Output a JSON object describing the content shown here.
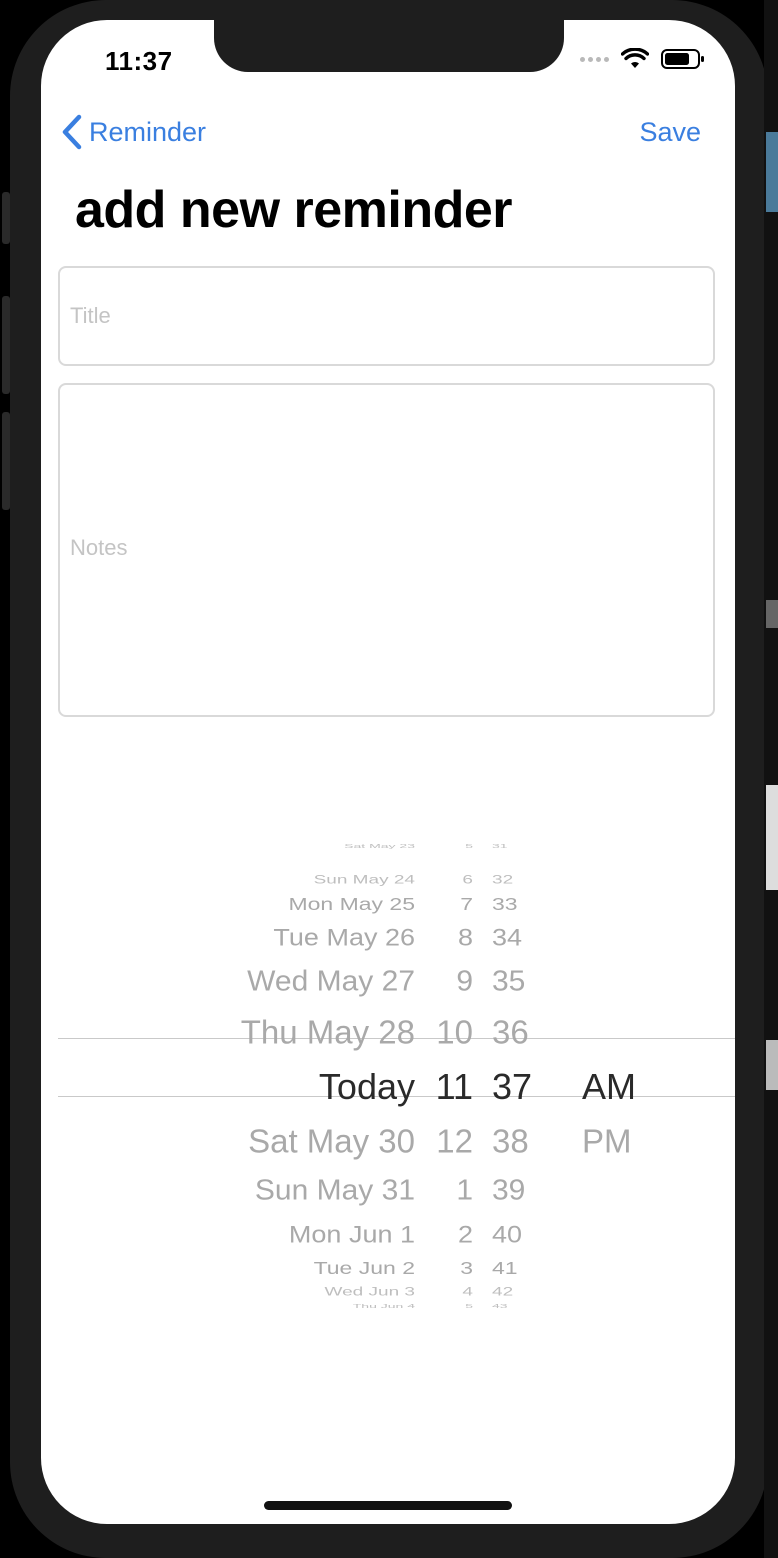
{
  "status_bar": {
    "time": "11:37"
  },
  "nav": {
    "back_label": "Reminder",
    "save_label": "Save"
  },
  "page": {
    "title": "add new reminder"
  },
  "form": {
    "title_placeholder": "Title",
    "title_value": "",
    "notes_placeholder": "Notes",
    "notes_value": ""
  },
  "picker": {
    "rows": [
      {
        "date": "Sat May 23",
        "hour": "5",
        "minute": "31",
        "ampm": ""
      },
      {
        "date": "Sun May 24",
        "hour": "6",
        "minute": "32",
        "ampm": ""
      },
      {
        "date": "Mon May 25",
        "hour": "7",
        "minute": "33",
        "ampm": ""
      },
      {
        "date": "Tue May 26",
        "hour": "8",
        "minute": "34",
        "ampm": ""
      },
      {
        "date": "Wed May 27",
        "hour": "9",
        "minute": "35",
        "ampm": ""
      },
      {
        "date": "Thu May 28",
        "hour": "10",
        "minute": "36",
        "ampm": ""
      },
      {
        "date": "Today",
        "hour": "11",
        "minute": "37",
        "ampm": "AM"
      },
      {
        "date": "Sat May 30",
        "hour": "12",
        "minute": "38",
        "ampm": "PM"
      },
      {
        "date": "Sun May 31",
        "hour": "1",
        "minute": "39",
        "ampm": ""
      },
      {
        "date": "Mon Jun 1",
        "hour": "2",
        "minute": "40",
        "ampm": ""
      },
      {
        "date": "Tue Jun 2",
        "hour": "3",
        "minute": "41",
        "ampm": ""
      },
      {
        "date": "Wed Jun 3",
        "hour": "4",
        "minute": "42",
        "ampm": ""
      },
      {
        "date": "Thu Jun 4",
        "hour": "5",
        "minute": "43",
        "ampm": ""
      }
    ],
    "selected": {
      "date": "Today",
      "hour": "11",
      "minute": "37",
      "ampm": "AM"
    }
  },
  "colors": {
    "accent": "#3a7fe0",
    "placeholder": "#c4c4c4",
    "picker_dim": "#a9a9a9"
  }
}
